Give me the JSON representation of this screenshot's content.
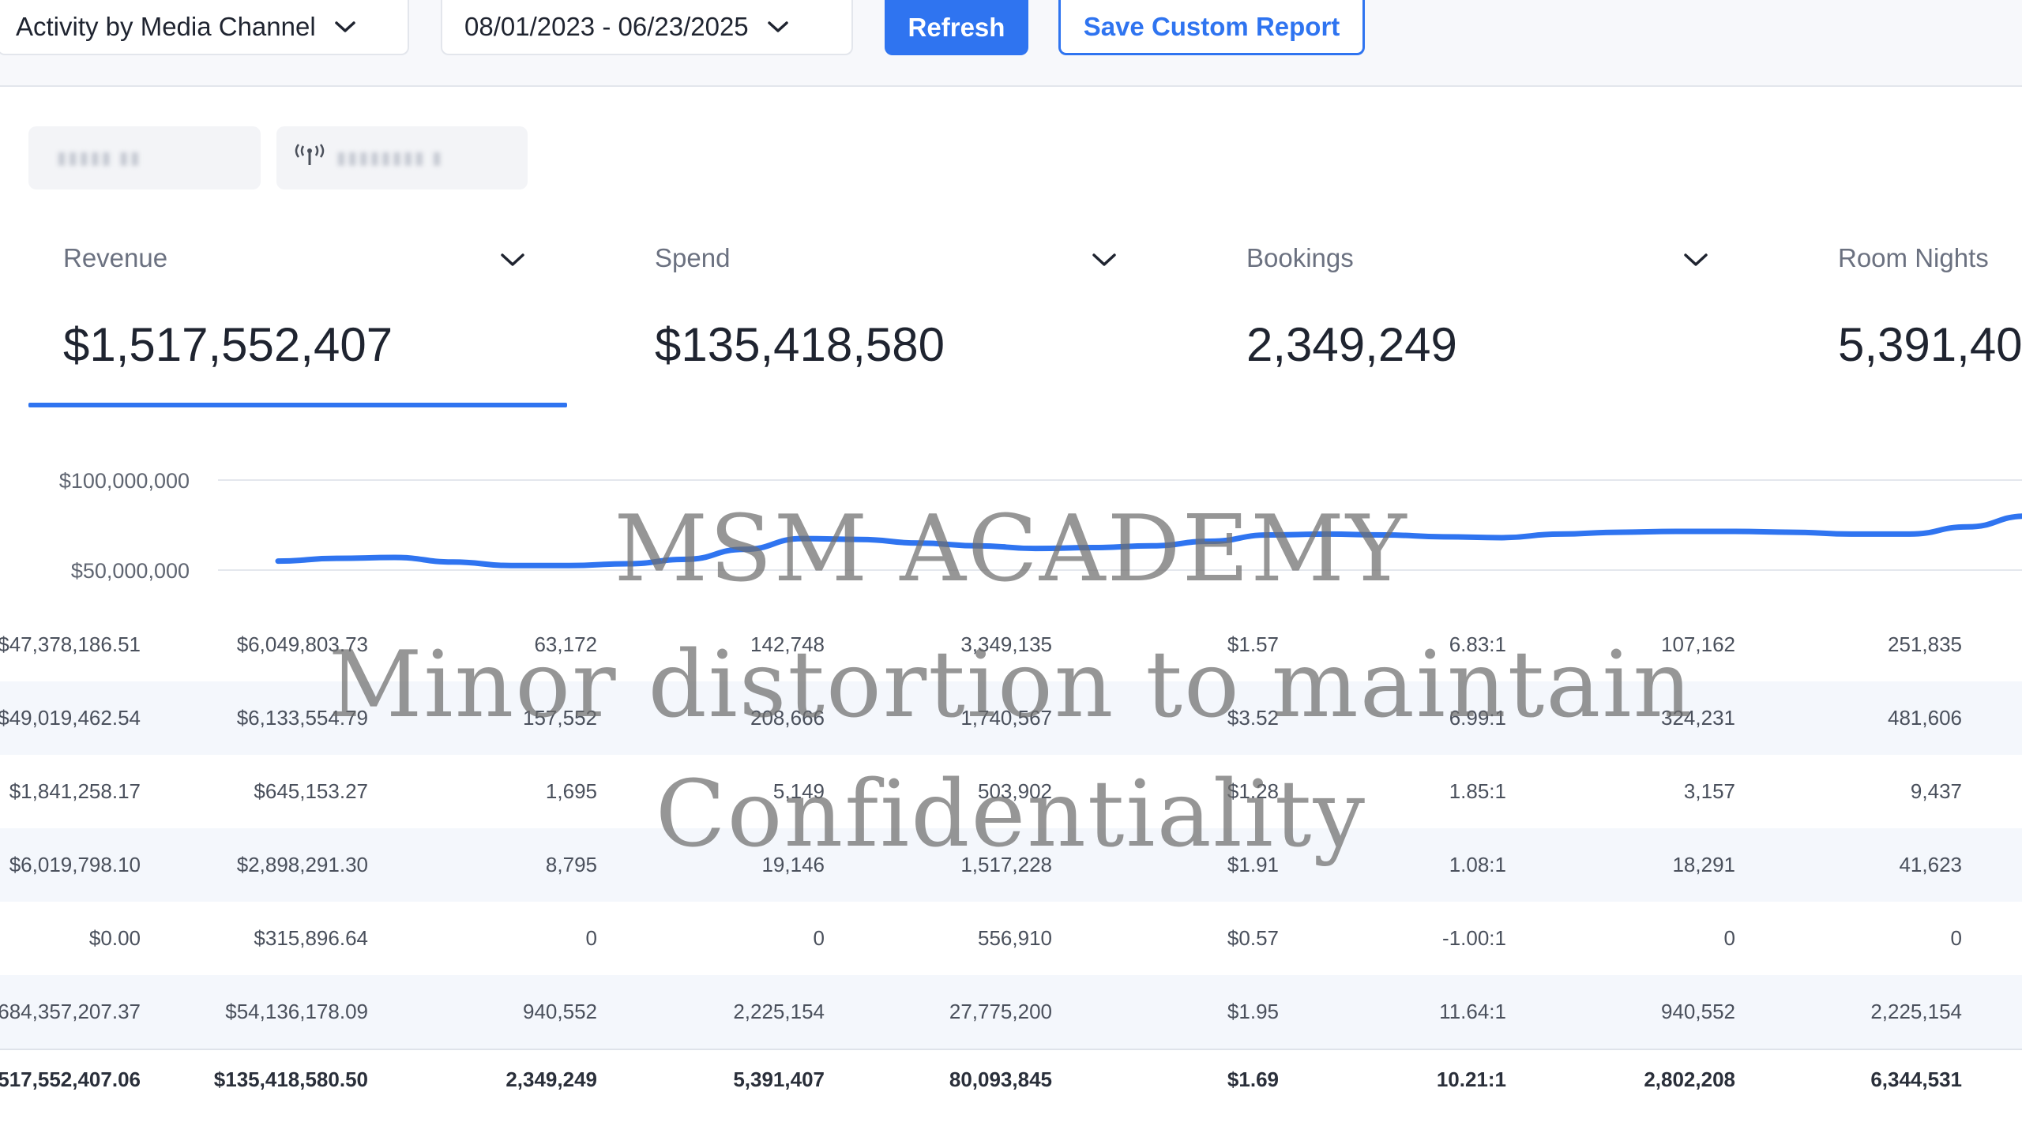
{
  "toolbar": {
    "report_selector": "Activity by Media Channel",
    "date_range": "08/01/2023 - 06/23/2025",
    "refresh_label": "Refresh",
    "save_label": "Save Custom Report"
  },
  "icons": {
    "chevron": "chevron-down-icon",
    "signal": "signal-icon"
  },
  "colors": {
    "accent": "#2f74f0",
    "row_alt": "#f4f7fc",
    "watermark": "#6e6e6e"
  },
  "kpis": [
    {
      "label": "Revenue",
      "value": "$1,517,552,407",
      "selected": true
    },
    {
      "label": "Spend",
      "value": "$135,418,580",
      "selected": false
    },
    {
      "label": "Bookings",
      "value": "2,349,249",
      "selected": false
    },
    {
      "label": "Room Nights",
      "value": "5,391,40",
      "selected": false
    }
  ],
  "chart_data": {
    "type": "line",
    "series": [
      {
        "values": [
          55000000,
          56500000,
          57000000,
          54500000,
          52500000,
          52500000,
          53500000,
          56000000,
          61500000,
          67500000,
          67000000,
          65000000,
          63500000,
          62000000,
          62500000,
          63500000,
          66000000,
          69500000,
          70000000,
          69500000,
          68500000,
          68000000,
          70000000,
          71000000,
          71500000,
          71500000,
          71000000,
          70000000,
          70000000,
          74000000,
          80000000
        ]
      }
    ],
    "y_ticks": [
      "$100,000,000",
      "$50,000,000"
    ],
    "ylim": [
      30000000,
      115000000
    ],
    "grid": true
  },
  "table": {
    "rows": [
      [
        "$47,378,186.51",
        "$6,049,803.73",
        "63,172",
        "142,748",
        "3,349,135",
        "$1.57",
        "6.83:1",
        "107,162",
        "251,835"
      ],
      [
        "$49,019,462.54",
        "$6,133,554.79",
        "157,552",
        "208,666",
        "1,740,567",
        "$3.52",
        "6.99:1",
        "324,231",
        "481,606"
      ],
      [
        "$1,841,258.17",
        "$645,153.27",
        "1,695",
        "5,149",
        "503,902",
        "$1.28",
        "1.85:1",
        "3,157",
        "9,437"
      ],
      [
        "$6,019,798.10",
        "$2,898,291.30",
        "8,795",
        "19,146",
        "1,517,228",
        "$1.91",
        "1.08:1",
        "18,291",
        "41,623"
      ],
      [
        "$0.00",
        "$315,896.64",
        "0",
        "0",
        "556,910",
        "$0.57",
        "-1.00:1",
        "0",
        "0"
      ],
      [
        "684,357,207.37",
        "$54,136,178.09",
        "940,552",
        "2,225,154",
        "27,775,200",
        "$1.95",
        "11.64:1",
        "940,552",
        "2,225,154"
      ]
    ],
    "total": [
      "517,552,407.06",
      "$135,418,580.50",
      "2,349,249",
      "5,391,407",
      "80,093,845",
      "$1.69",
      "10.21:1",
      "2,802,208",
      "6,344,531"
    ]
  },
  "watermark": {
    "line1": "MSM ACADEMY",
    "line2": "Minor distortion to maintain",
    "line3": "Confidentiality"
  }
}
